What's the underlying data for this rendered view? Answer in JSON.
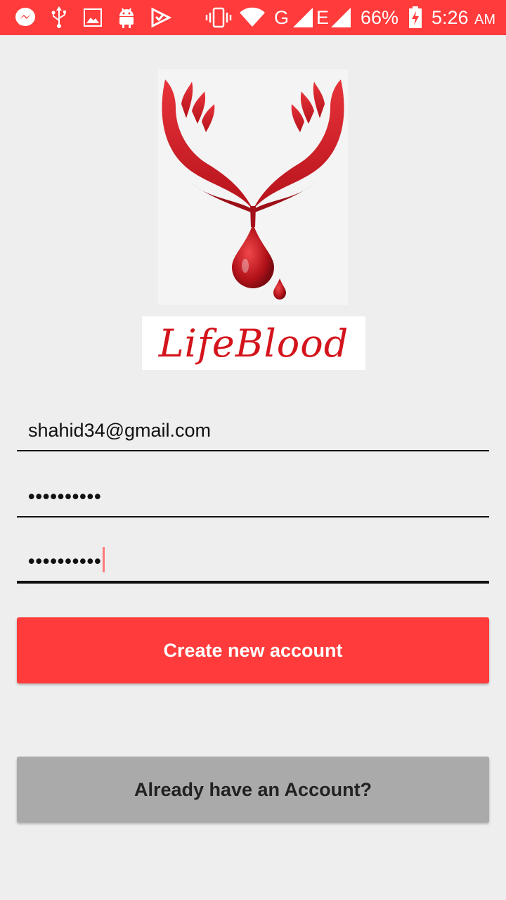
{
  "status_bar": {
    "battery": "66%",
    "time": "5:26",
    "ampm": "AM",
    "network_g": "G",
    "network_e": "E",
    "icons": [
      "messenger-icon",
      "usb-icon",
      "gallery-icon",
      "android-icon",
      "checklist-icon",
      "vibrate-icon",
      "wifi-icon",
      "signal-icon",
      "battery-icon"
    ]
  },
  "logo": {
    "text": "LifeBlood",
    "brand_color": "#d4141c"
  },
  "form": {
    "email_value": "shahid34@gmail.com",
    "password_value": "••••••••••",
    "confirm_password_value": "••••••••••"
  },
  "buttons": {
    "create_label": "Create new account",
    "login_label": "Already have an Account?"
  },
  "colors": {
    "accent": "#ff3b3b",
    "background": "#eeeeee",
    "secondary_button": "#aaaaaa"
  }
}
